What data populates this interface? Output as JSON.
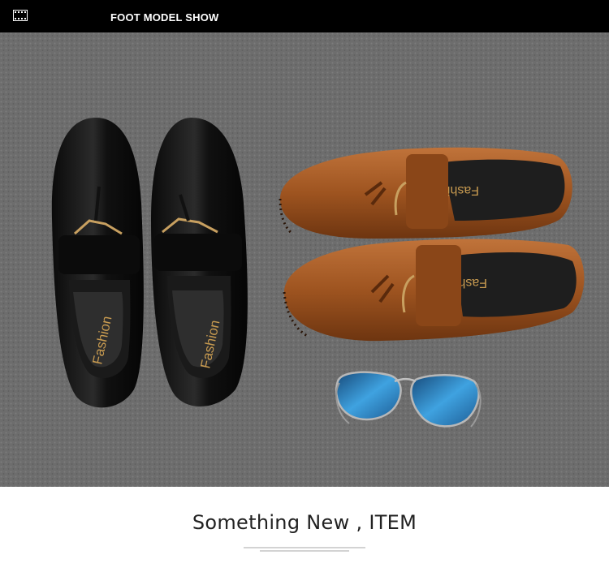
{
  "header": {
    "title": "FOOT MODEL SHOW",
    "icon": "film-strip-icon"
  },
  "photo": {
    "insole_label": "Fashion",
    "colors": {
      "carpet": "#6f6f6f",
      "black_leather": "#141414",
      "brown_leather": "#a85a25",
      "lens": "#2a7fc0",
      "hardware": "#c8a060"
    }
  },
  "caption": {
    "title": "Something New ,  ITEM"
  }
}
